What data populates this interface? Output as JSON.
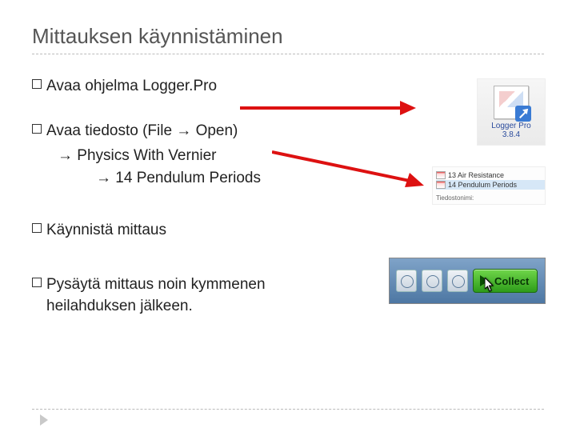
{
  "title": "Mittauksen käynnistäminen",
  "bullets": {
    "b1": {
      "prefix": "Avaa",
      "rest": " ohjelma Logger.Pro"
    },
    "b2": {
      "prefix": "Avaa",
      "rest": " tiedosto (File → Open)"
    },
    "b2_sub1": "→ Physics With Vernier",
    "b2_sub2": "→ 14 Pendulum Periods",
    "b3": {
      "prefix": "Käynnistä",
      "rest": " mittaus"
    },
    "b4": {
      "prefix": "Pysäytä",
      "rest": " mittaus noin kymmenen heilahduksen jälkeen."
    }
  },
  "icon_loggerpro": {
    "label_line1": "Logger Pro",
    "label_line2": "3.8.4"
  },
  "file_list": {
    "row1": "13 Air Resistance",
    "row2": "14 Pendulum Periods",
    "caption": "Tiedostonimi:"
  },
  "collect_button": "Collect"
}
